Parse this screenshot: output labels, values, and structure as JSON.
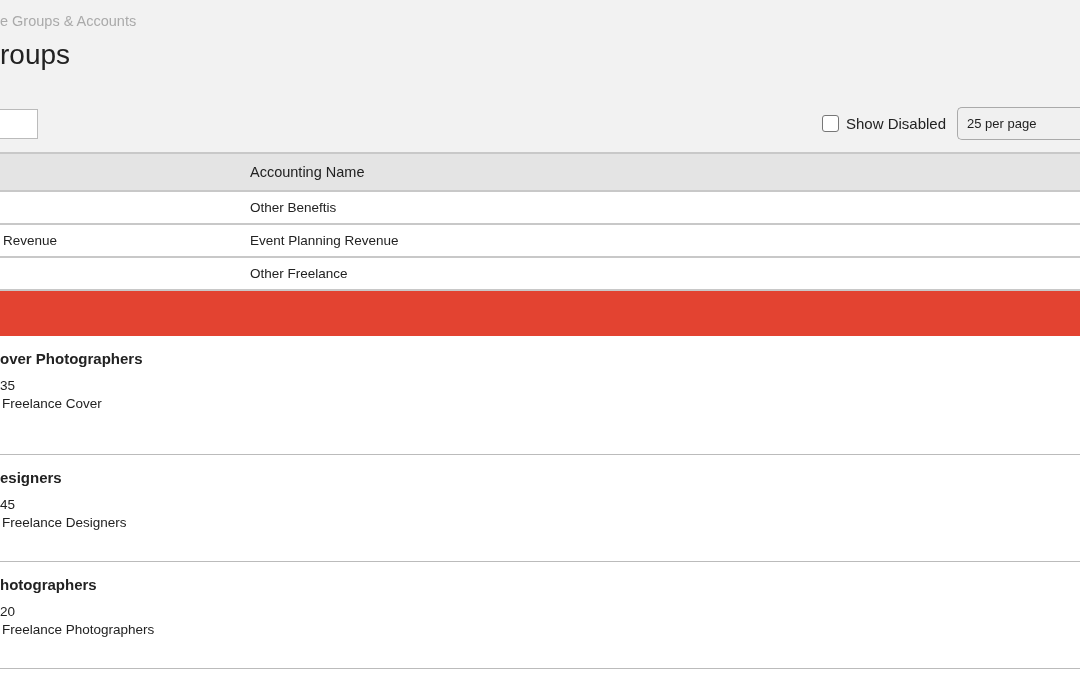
{
  "breadcrumb": "e Groups & Accounts",
  "title": "roups",
  "show_disabled": {
    "label": "Show Disabled",
    "checked": false
  },
  "per_page": {
    "value": "25 per page"
  },
  "table": {
    "columns": [
      "Accounting Name"
    ],
    "rows": [
      {
        "accounting_name": "Other Beneftis"
      },
      {
        "column_1": "Revenue",
        "accounting_name": "Event Planning Revenue"
      },
      {
        "accounting_name": "Other Freelance"
      }
    ]
  },
  "groups": [
    {
      "name": "over Photographers",
      "number": "35",
      "account": "Freelance Cover"
    },
    {
      "name": "esigners",
      "number": "45",
      "account": "Freelance Designers"
    },
    {
      "name": "hotographers",
      "number": "20",
      "account": "Freelance Photographers"
    }
  ]
}
